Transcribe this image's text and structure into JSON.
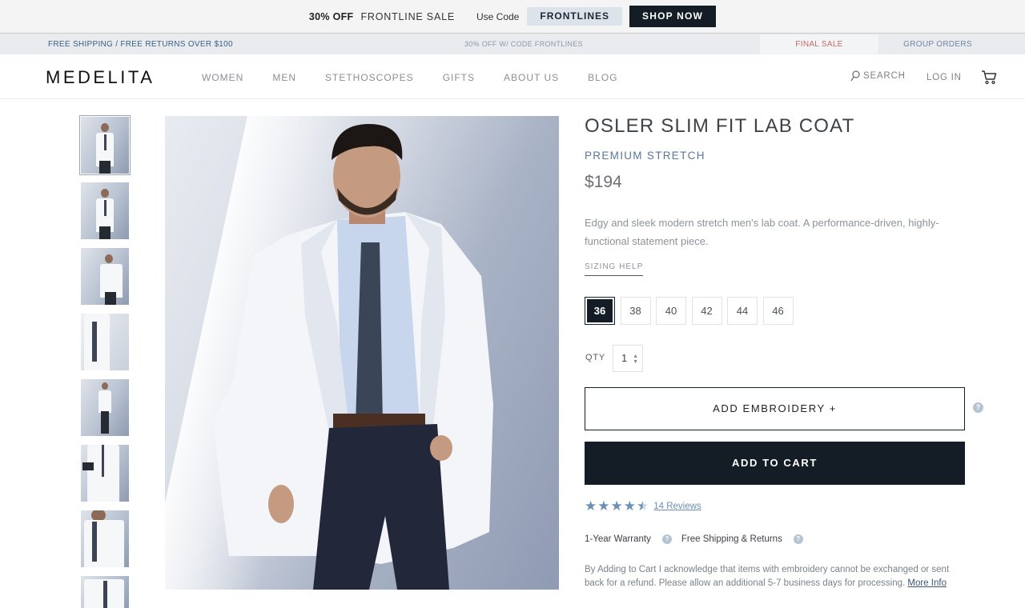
{
  "promo": {
    "bold": "30% OFF",
    "sale": "FRONTLINE SALE",
    "use_code": "Use Code",
    "code": "FRONTLINES",
    "shop_now": "SHOP NOW"
  },
  "subbar": {
    "shipping": "FREE SHIPPING / FREE RETURNS OVER $100",
    "middle": "30% OFF W/ CODE FRONTLINES",
    "final_sale": "FINAL SALE",
    "group_orders": "GROUP ORDERS"
  },
  "header": {
    "logo": "MEDELITA",
    "nav": [
      "WOMEN",
      "MEN",
      "STETHOSCOPES",
      "GIFTS",
      "ABOUT US",
      "BLOG"
    ],
    "search": "SEARCH",
    "login": "LOG IN"
  },
  "product": {
    "title": "OSLER SLIM FIT LAB COAT",
    "subtitle": "PREMIUM STRETCH",
    "price": "$194",
    "description": "Edgy and sleek modern stretch men's lab coat. A performance-driven, highly-functional statement piece.",
    "sizing_help": "SIZING HELP",
    "sizes": [
      "36",
      "38",
      "40",
      "42",
      "44",
      "46"
    ],
    "selected_size": "36",
    "qty_label": "QTY",
    "qty_value": "1",
    "embroidery": "ADD EMBROIDERY +",
    "add_to_cart": "ADD TO CART",
    "rating": 4.5,
    "reviews": "14 Reviews",
    "warranty": "1-Year Warranty",
    "shipping": "Free Shipping & Returns",
    "disclaimer": "By Adding to Cart I acknowledge that items with embroidery cannot be exchanged or sent back for a refund. Please allow an additional 5-7 business days for processing.",
    "more_info": "More Info"
  },
  "colors": {
    "dark": "#141d26",
    "accent_blue": "#58779a",
    "star": "#6b8fb6"
  }
}
